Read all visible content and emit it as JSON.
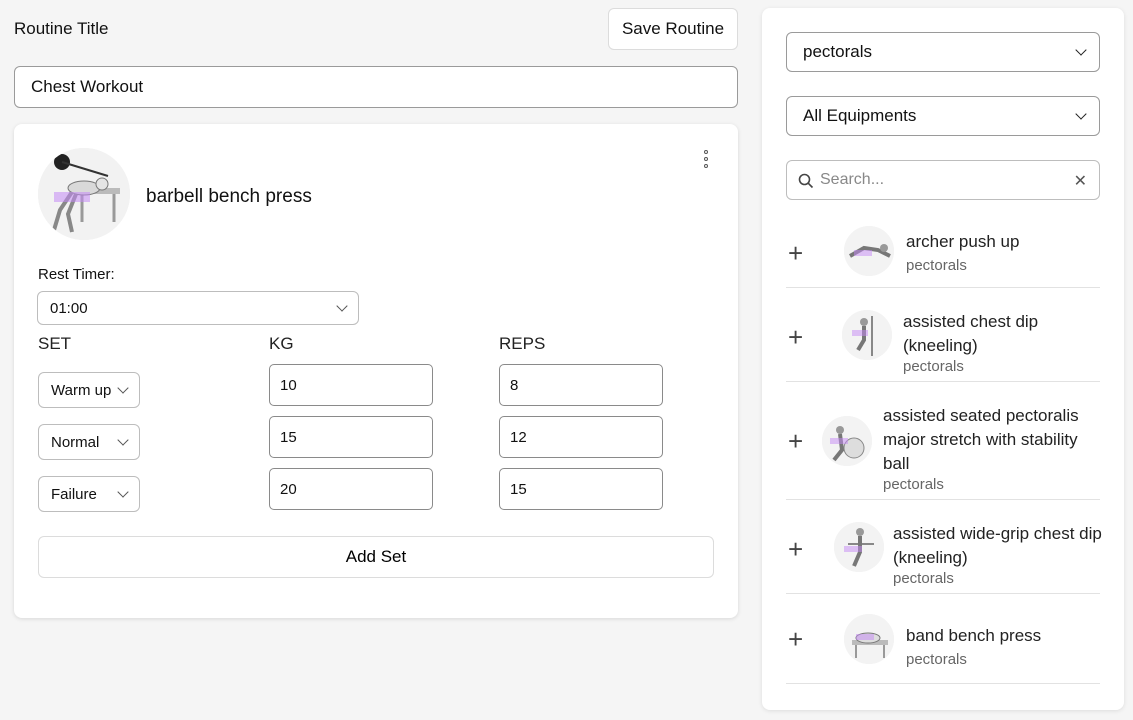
{
  "routine": {
    "title_label": "Routine Title",
    "save_label": "Save Routine",
    "title_value": "Chest Workout"
  },
  "exercise": {
    "name": "barbell bench press",
    "rest_label": "Rest Timer:",
    "rest_value": "01:00",
    "headers": {
      "set": "SET",
      "kg": "KG",
      "reps": "REPS"
    },
    "sets": [
      {
        "type": "Warm up",
        "kg": "10",
        "reps": "8"
      },
      {
        "type": "Normal",
        "kg": "15",
        "reps": "12"
      },
      {
        "type": "Failure",
        "kg": "20",
        "reps": "15"
      }
    ],
    "add_set_label": "Add Set"
  },
  "library": {
    "muscle_filter": "pectorals",
    "equipment_filter": "All Equipments",
    "search_placeholder": "Search...",
    "items": [
      {
        "name": "archer push up",
        "muscle": "pectorals"
      },
      {
        "name": "assisted chest dip (kneeling)",
        "muscle": "pectorals"
      },
      {
        "name": "assisted seated pectoralis major stretch with stability ball",
        "muscle": "pectorals"
      },
      {
        "name": "assisted wide-grip chest dip (kneeling)",
        "muscle": "pectorals"
      },
      {
        "name": "band bench press",
        "muscle": "pectorals"
      }
    ]
  },
  "colors": {
    "accent_watermark": "#c58af5",
    "border": "#bdbdbd",
    "panel_bg": "#ffffff",
    "page_bg": "#f5f5f5"
  }
}
